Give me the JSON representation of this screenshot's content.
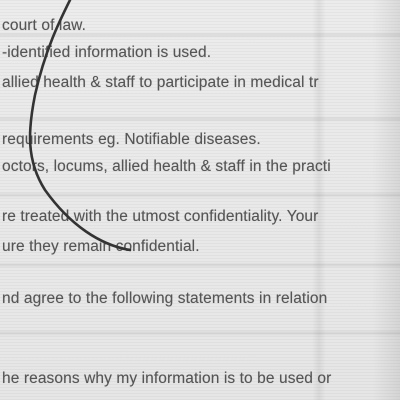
{
  "document": {
    "lines": [
      "court of law.",
      "-identified information is used.",
      " allied health & staff to participate in medical tr",
      "requirements eg. Notifiable diseases.",
      "octors, locums, allied health & staff in the practi",
      "re treated with the utmost confidentiality. Your",
      "ure they remain confidential.",
      "nd agree to the following statements in relation",
      "he reasons why my information is to be used or"
    ]
  },
  "colors": {
    "text": "#555555",
    "paper": "#e9e9e9",
    "pen_stroke": "#333333"
  }
}
